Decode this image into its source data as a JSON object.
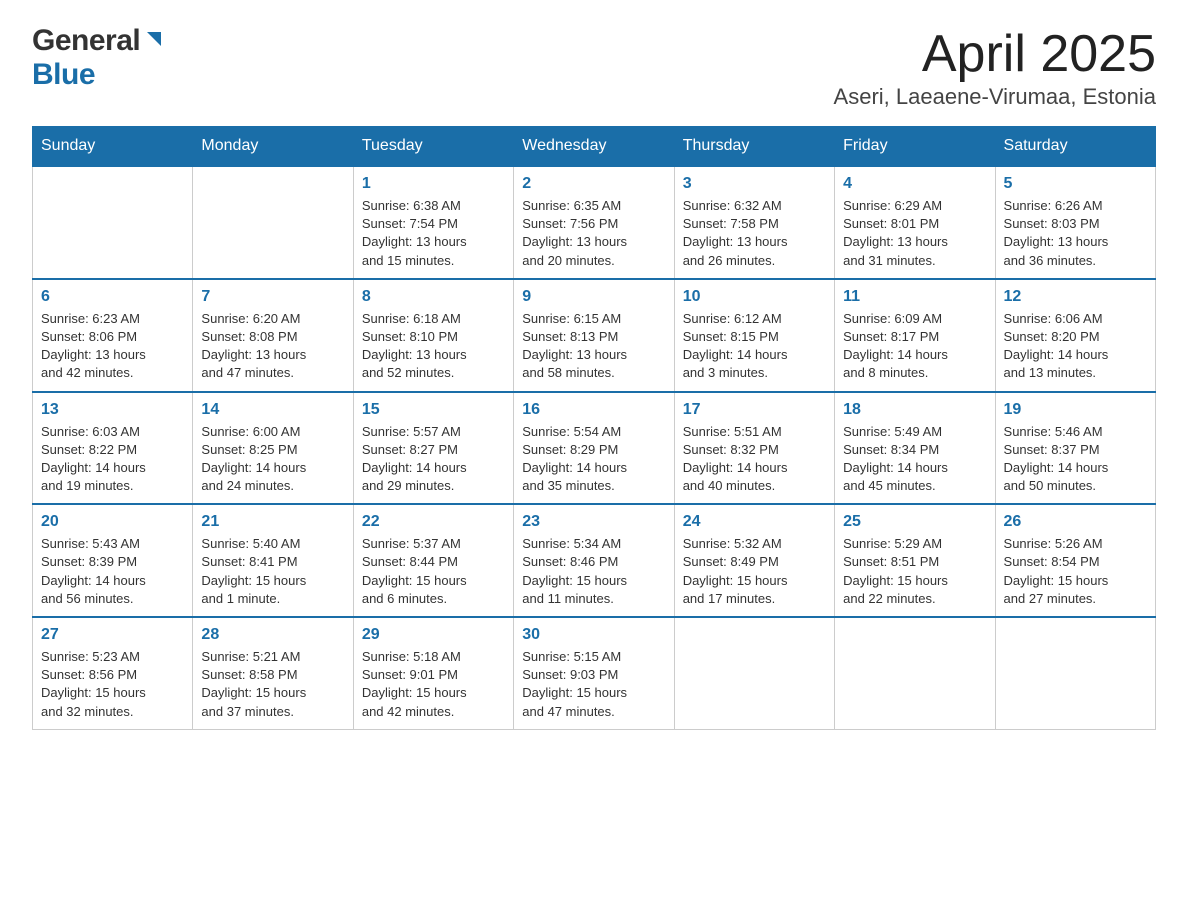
{
  "header": {
    "logo_general": "General",
    "logo_blue": "Blue",
    "title": "April 2025",
    "subtitle": "Aseri, Laeaene-Virumaa, Estonia"
  },
  "calendar": {
    "days_of_week": [
      "Sunday",
      "Monday",
      "Tuesday",
      "Wednesday",
      "Thursday",
      "Friday",
      "Saturday"
    ],
    "weeks": [
      [
        {
          "day": "",
          "info": ""
        },
        {
          "day": "",
          "info": ""
        },
        {
          "day": "1",
          "info": "Sunrise: 6:38 AM\nSunset: 7:54 PM\nDaylight: 13 hours\nand 15 minutes."
        },
        {
          "day": "2",
          "info": "Sunrise: 6:35 AM\nSunset: 7:56 PM\nDaylight: 13 hours\nand 20 minutes."
        },
        {
          "day": "3",
          "info": "Sunrise: 6:32 AM\nSunset: 7:58 PM\nDaylight: 13 hours\nand 26 minutes."
        },
        {
          "day": "4",
          "info": "Sunrise: 6:29 AM\nSunset: 8:01 PM\nDaylight: 13 hours\nand 31 minutes."
        },
        {
          "day": "5",
          "info": "Sunrise: 6:26 AM\nSunset: 8:03 PM\nDaylight: 13 hours\nand 36 minutes."
        }
      ],
      [
        {
          "day": "6",
          "info": "Sunrise: 6:23 AM\nSunset: 8:06 PM\nDaylight: 13 hours\nand 42 minutes."
        },
        {
          "day": "7",
          "info": "Sunrise: 6:20 AM\nSunset: 8:08 PM\nDaylight: 13 hours\nand 47 minutes."
        },
        {
          "day": "8",
          "info": "Sunrise: 6:18 AM\nSunset: 8:10 PM\nDaylight: 13 hours\nand 52 minutes."
        },
        {
          "day": "9",
          "info": "Sunrise: 6:15 AM\nSunset: 8:13 PM\nDaylight: 13 hours\nand 58 minutes."
        },
        {
          "day": "10",
          "info": "Sunrise: 6:12 AM\nSunset: 8:15 PM\nDaylight: 14 hours\nand 3 minutes."
        },
        {
          "day": "11",
          "info": "Sunrise: 6:09 AM\nSunset: 8:17 PM\nDaylight: 14 hours\nand 8 minutes."
        },
        {
          "day": "12",
          "info": "Sunrise: 6:06 AM\nSunset: 8:20 PM\nDaylight: 14 hours\nand 13 minutes."
        }
      ],
      [
        {
          "day": "13",
          "info": "Sunrise: 6:03 AM\nSunset: 8:22 PM\nDaylight: 14 hours\nand 19 minutes."
        },
        {
          "day": "14",
          "info": "Sunrise: 6:00 AM\nSunset: 8:25 PM\nDaylight: 14 hours\nand 24 minutes."
        },
        {
          "day": "15",
          "info": "Sunrise: 5:57 AM\nSunset: 8:27 PM\nDaylight: 14 hours\nand 29 minutes."
        },
        {
          "day": "16",
          "info": "Sunrise: 5:54 AM\nSunset: 8:29 PM\nDaylight: 14 hours\nand 35 minutes."
        },
        {
          "day": "17",
          "info": "Sunrise: 5:51 AM\nSunset: 8:32 PM\nDaylight: 14 hours\nand 40 minutes."
        },
        {
          "day": "18",
          "info": "Sunrise: 5:49 AM\nSunset: 8:34 PM\nDaylight: 14 hours\nand 45 minutes."
        },
        {
          "day": "19",
          "info": "Sunrise: 5:46 AM\nSunset: 8:37 PM\nDaylight: 14 hours\nand 50 minutes."
        }
      ],
      [
        {
          "day": "20",
          "info": "Sunrise: 5:43 AM\nSunset: 8:39 PM\nDaylight: 14 hours\nand 56 minutes."
        },
        {
          "day": "21",
          "info": "Sunrise: 5:40 AM\nSunset: 8:41 PM\nDaylight: 15 hours\nand 1 minute."
        },
        {
          "day": "22",
          "info": "Sunrise: 5:37 AM\nSunset: 8:44 PM\nDaylight: 15 hours\nand 6 minutes."
        },
        {
          "day": "23",
          "info": "Sunrise: 5:34 AM\nSunset: 8:46 PM\nDaylight: 15 hours\nand 11 minutes."
        },
        {
          "day": "24",
          "info": "Sunrise: 5:32 AM\nSunset: 8:49 PM\nDaylight: 15 hours\nand 17 minutes."
        },
        {
          "day": "25",
          "info": "Sunrise: 5:29 AM\nSunset: 8:51 PM\nDaylight: 15 hours\nand 22 minutes."
        },
        {
          "day": "26",
          "info": "Sunrise: 5:26 AM\nSunset: 8:54 PM\nDaylight: 15 hours\nand 27 minutes."
        }
      ],
      [
        {
          "day": "27",
          "info": "Sunrise: 5:23 AM\nSunset: 8:56 PM\nDaylight: 15 hours\nand 32 minutes."
        },
        {
          "day": "28",
          "info": "Sunrise: 5:21 AM\nSunset: 8:58 PM\nDaylight: 15 hours\nand 37 minutes."
        },
        {
          "day": "29",
          "info": "Sunrise: 5:18 AM\nSunset: 9:01 PM\nDaylight: 15 hours\nand 42 minutes."
        },
        {
          "day": "30",
          "info": "Sunrise: 5:15 AM\nSunset: 9:03 PM\nDaylight: 15 hours\nand 47 minutes."
        },
        {
          "day": "",
          "info": ""
        },
        {
          "day": "",
          "info": ""
        },
        {
          "day": "",
          "info": ""
        }
      ]
    ]
  }
}
